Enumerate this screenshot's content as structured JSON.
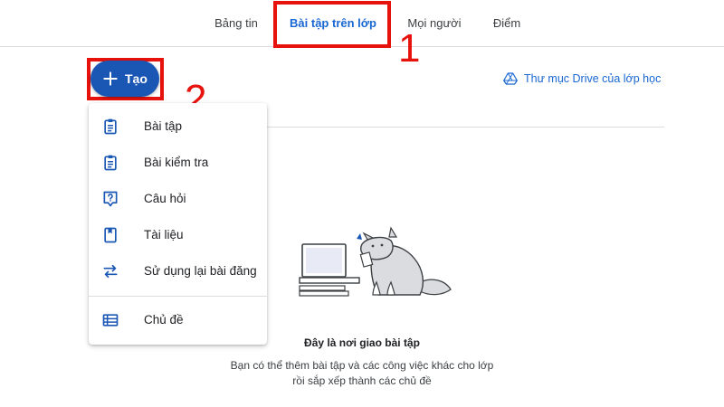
{
  "tabs": [
    {
      "label": "Bảng tin"
    },
    {
      "label": "Bài tập trên lớp"
    },
    {
      "label": "Mọi người"
    },
    {
      "label": "Điểm"
    }
  ],
  "annotations": {
    "one": "1",
    "two": "2",
    "color": "#e8120c"
  },
  "create_button": {
    "label": "Tạo",
    "icon": "plus-icon"
  },
  "drive_link": {
    "label": "Thư mục Drive của lớp học",
    "icon": "drive-icon"
  },
  "menu": {
    "items": [
      {
        "label": "Bài tập",
        "icon": "assignment-icon"
      },
      {
        "label": "Bài kiểm tra",
        "icon": "quiz-assignment-icon"
      },
      {
        "label": "Câu hỏi",
        "icon": "question-icon"
      },
      {
        "label": "Tài liệu",
        "icon": "material-icon"
      },
      {
        "label": "Sử dụng lại bài đăng",
        "icon": "reuse-post-icon"
      },
      {
        "label": "Chủ đề",
        "icon": "topic-icon"
      }
    ]
  },
  "empty_state": {
    "title": "Đây là nơi giao bài tập",
    "line1": "Bạn có thể thêm bài tập và các công việc khác cho lớp",
    "line2": "rồi sắp xếp thành các chủ đề"
  },
  "colors": {
    "accent": "#1967d2",
    "button": "#1a57b5",
    "icon": "#1a57b5"
  }
}
